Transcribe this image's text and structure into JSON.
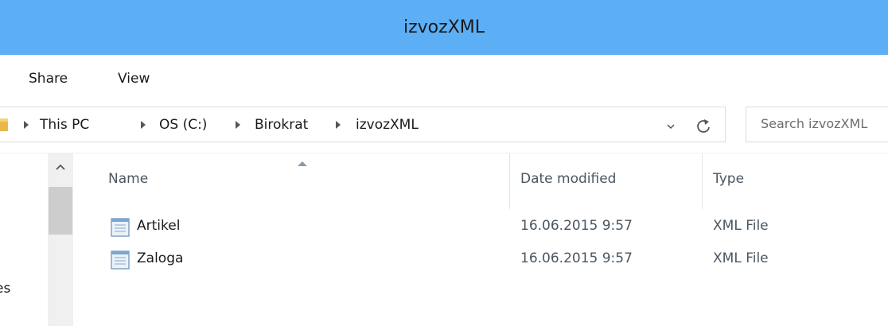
{
  "window": {
    "title": "izvozXML"
  },
  "ribbon": {
    "tabs": [
      "Share",
      "View"
    ]
  },
  "address": {
    "crumbs": [
      "This PC",
      "OS (C:)",
      "Birokrat",
      "izvozXML"
    ]
  },
  "search": {
    "placeholder": "Search izvozXML"
  },
  "navpane": {
    "partial_label": "es"
  },
  "columns": {
    "name": "Name",
    "date": "Date modified",
    "type": "Type"
  },
  "files": [
    {
      "name": "Artikel",
      "date": "16.06.2015 9:57",
      "type": "XML File",
      "icon": "xml-file-icon"
    },
    {
      "name": "Zaloga",
      "date": "16.06.2015 9:57",
      "type": "XML File",
      "icon": "xml-file-icon"
    }
  ],
  "colors": {
    "titlebar": "#5caff5"
  }
}
